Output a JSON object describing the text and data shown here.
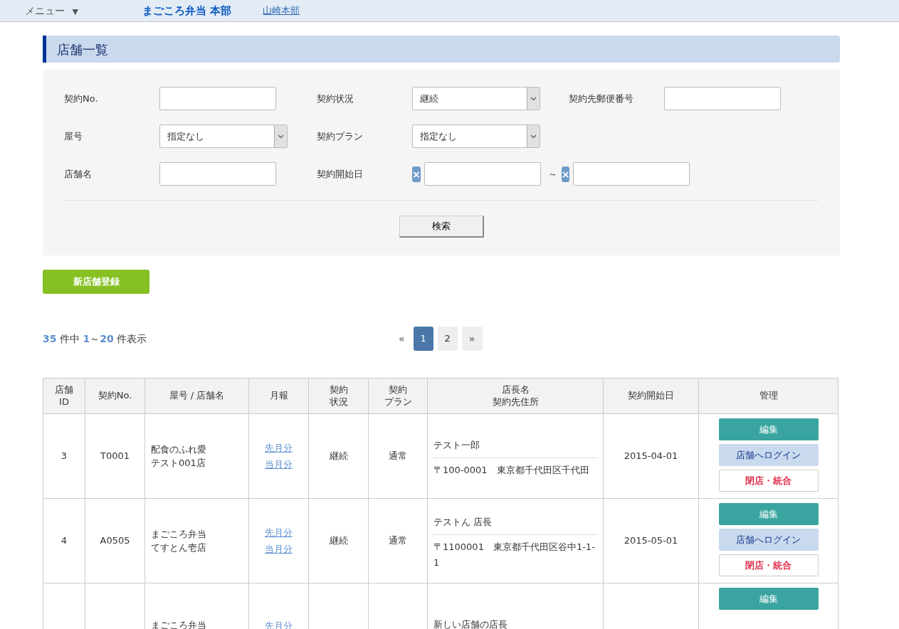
{
  "header": {
    "menu_label": "メニュー",
    "menu_caret": "▼",
    "site_title": "まごころ弁当 本部",
    "user_link": "山崎本部"
  },
  "page_title": "店舗一覧",
  "search": {
    "rows": [
      [
        {
          "label": "契約No.",
          "kind": "text"
        },
        {
          "label": "契約状況",
          "kind": "select",
          "value": "継続"
        },
        {
          "label": "契約先郵便番号",
          "kind": "text"
        }
      ],
      [
        {
          "label": "屋号",
          "kind": "select",
          "value": "指定なし"
        },
        {
          "label": "契約プラン",
          "kind": "select",
          "value": "指定なし"
        }
      ],
      [
        {
          "label": "店舗名",
          "kind": "text"
        },
        {
          "label": "契約開始日",
          "kind": "daterange",
          "clear": "×",
          "separator": "～"
        }
      ]
    ],
    "button": "検索"
  },
  "new_button": "新店舗登録",
  "summary": {
    "total": "35",
    "of": "件中",
    "from": "1",
    "tilde": "～",
    "to": "20",
    "suffix": "件表示"
  },
  "pagination": {
    "prev": "«",
    "pages": [
      {
        "label": "1",
        "selected": true
      },
      {
        "label": "2",
        "selected": false
      }
    ],
    "next": "»"
  },
  "table": {
    "columns": [
      [
        "店舗",
        "ID"
      ],
      [
        "契約No."
      ],
      [
        "屋号 / 店舗名"
      ],
      [
        "月報"
      ],
      [
        "契約",
        "状況"
      ],
      [
        "契約",
        "プラン"
      ],
      [
        "店長名",
        "契約先住所"
      ],
      [
        "契約開始日"
      ],
      [
        "管理"
      ]
    ],
    "rows": [
      {
        "id": "3",
        "contract_no": "T0001",
        "name": [
          "配食のふれ愛",
          "テスト001店"
        ],
        "reports": [
          "先月分",
          "当月分"
        ],
        "status": "継続",
        "plan": "通常",
        "manager": "テスト一郎",
        "address": "〒100-0001　東京都千代田区千代田",
        "start_date": "2015-04-01",
        "actions": [
          {
            "label": "編集",
            "kind": "edit"
          },
          {
            "label": "店舗へログイン",
            "kind": "login"
          },
          {
            "label": "閉店・統合",
            "kind": "close"
          }
        ]
      },
      {
        "id": "4",
        "contract_no": "A0505",
        "name": [
          "まごころ弁当",
          "てすとん壱店"
        ],
        "reports": [
          "先月分",
          "当月分"
        ],
        "status": "継続",
        "plan": "通常",
        "manager": "テストん 店長",
        "address": "〒1100001　東京都千代田区谷中1-1-1",
        "start_date": "2015-05-01",
        "actions": [
          {
            "label": "編集",
            "kind": "edit"
          },
          {
            "label": "店舗へログイン",
            "kind": "login"
          },
          {
            "label": "閉店・統合",
            "kind": "close"
          }
        ]
      },
      {
        "name": [
          "まごころ弁当"
        ],
        "reports": [
          "先月分"
        ],
        "manager": "新しい店舗の店長",
        "actions": [
          {
            "label": "編集",
            "kind": "edit"
          }
        ]
      }
    ]
  }
}
